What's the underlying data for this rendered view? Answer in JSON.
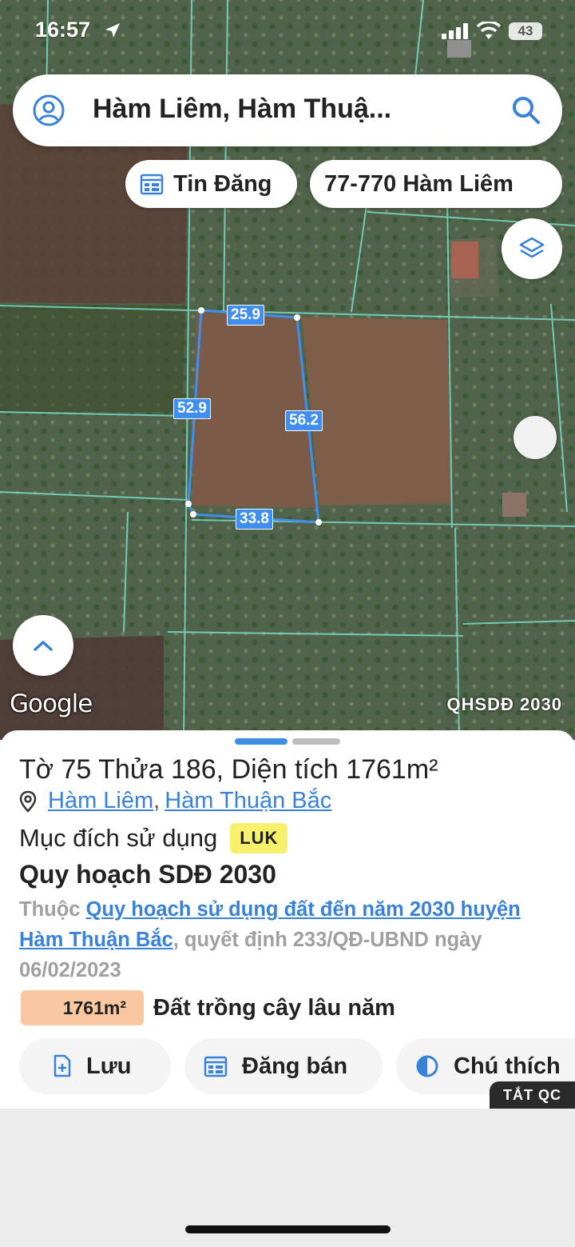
{
  "status_bar": {
    "time": "16:57",
    "battery": "43"
  },
  "search": {
    "query": "Hàm Liêm, Hàm Thuậ..."
  },
  "chips": {
    "news": "Tin Đăng",
    "parcel": "77-770 Hàm Liêm"
  },
  "map": {
    "edge_lengths": {
      "top": "25.9",
      "left": "52.9",
      "right": "56.2",
      "bottom": "33.8"
    },
    "attribution": "Google",
    "layer_name": "QHSDĐ 2030"
  },
  "parcel": {
    "title": "Tờ 75 Thửa 186, Diện tích 1761m²",
    "commune": "Hàm Liêm",
    "separator": ",",
    "district": "Hàm Thuận Bắc",
    "purpose_label": "Mục đích sử dụng",
    "purpose_code": "LUK",
    "plan_title": "Quy hoạch SDĐ 2030",
    "plan_prefix": "Thuộc",
    "plan_link": "Quy hoạch sử dụng đất đến năm 2030 huyện Hàm Thuận Bắc",
    "plan_suffix": ", quyết định 233/QĐ-UBND ngày 06/02/2023",
    "area_value": "1761m²",
    "area_type": "Đất trồng cây lâu năm"
  },
  "actions": {
    "save": "Lưu",
    "post_sale": "Đăng bán",
    "legend": "Chú thích"
  },
  "ad": {
    "off_label": "TẮT QC"
  },
  "colors": {
    "accent": "#3a82d8",
    "parcel_outline": "#3f8ef0",
    "luk_badge": "#f6f06a",
    "area_badge": "#f9c8a0"
  }
}
